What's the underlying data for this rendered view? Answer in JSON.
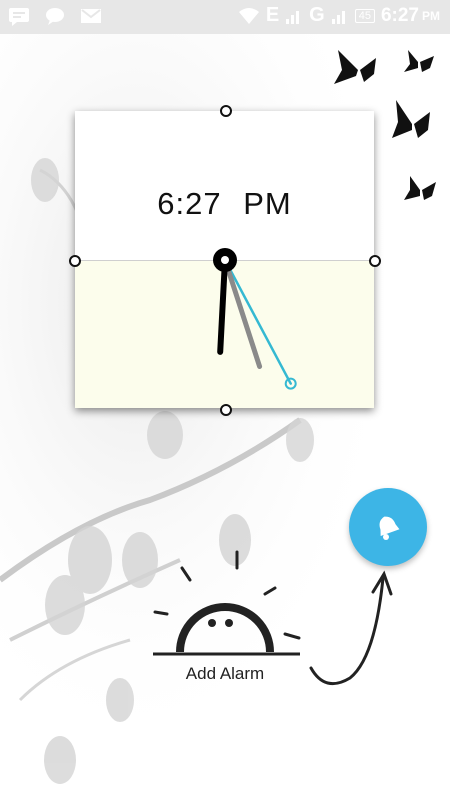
{
  "status_bar": {
    "network_e": "E",
    "network_g": "G",
    "battery": "45",
    "time": "6:27",
    "ampm": "PM",
    "icons": [
      "message-icon",
      "chat-bubble-icon",
      "gmail-icon",
      "wifi-icon",
      "signal-icon",
      "battery-icon"
    ]
  },
  "clock": {
    "time": "6:27",
    "period": "PM",
    "hour_hand_angle_deg": 183,
    "minute_hand_angle_deg": 162,
    "second_hand_angle_deg": 152
  },
  "add_alarm": {
    "label": "Add Alarm",
    "fab_icon": "bell-icon",
    "accent_color": "#3db5e6"
  },
  "decorations": {
    "butterfly_icon": "butterfly-icon",
    "sunrise_icon": "sunrise-face-icon",
    "arrow_icon": "curved-arrow-icon"
  }
}
